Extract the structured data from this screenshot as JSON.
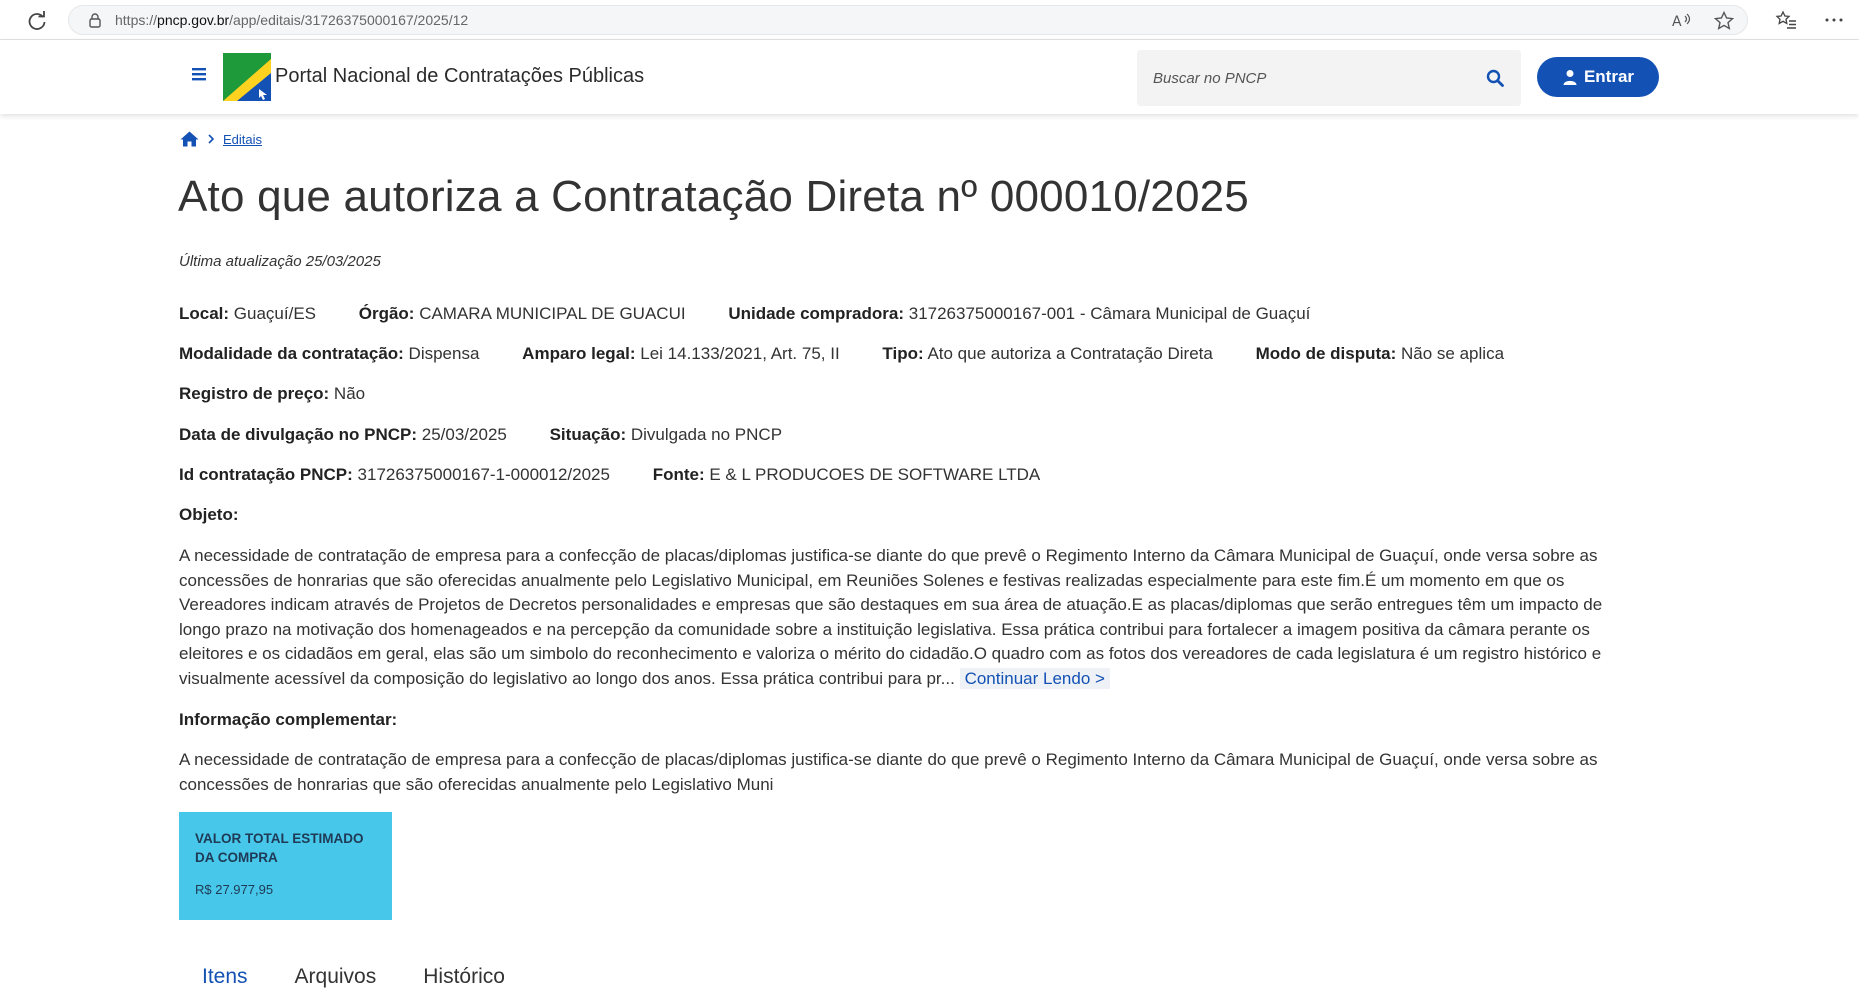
{
  "browser": {
    "url_prefix": "https://",
    "url_host": "pncp.gov.br",
    "url_path": "/app/editais/31726375000167/2025/12"
  },
  "header": {
    "portal_title": "Portal Nacional de Contratações Públicas",
    "search_placeholder": "Buscar no PNCP",
    "login_label": "Entrar"
  },
  "breadcrumb": {
    "editais": "Editais"
  },
  "page": {
    "title": "Ato que autoriza a Contratação Direta nº 000010/2025",
    "last_update": "Última atualização 25/03/2025"
  },
  "fields": {
    "local_label": "Local:",
    "local_value": " Guaçuí/ES",
    "orgao_label": "Órgão:",
    "orgao_value": " CAMARA MUNICIPAL DE GUACUI",
    "unidade_label": "Unidade compradora:",
    "unidade_value": " 31726375000167-001 - Câmara Municipal de Guaçuí",
    "modalidade_label": "Modalidade da contratação:",
    "modalidade_value": " Dispensa",
    "amparo_label": "Amparo legal:",
    "amparo_value": " Lei 14.133/2021, Art. 75, II",
    "tipo_label": "Tipo:",
    "tipo_value": " Ato que autoriza a Contratação Direta",
    "modo_label": "Modo de disputa:",
    "modo_value": " Não se aplica",
    "registro_label": "Registro de preço:",
    "registro_value": " Não",
    "data_label": "Data de divulgação no PNCP:",
    "data_value": " 25/03/2025",
    "situacao_label": "Situação:",
    "situacao_value": " Divulgada no PNCP",
    "id_label": "Id contratação PNCP:",
    "id_value": " 31726375000167-1-000012/2025",
    "fonte_label": "Fonte:",
    "fonte_value": " E & L PRODUCOES DE SOFTWARE LTDA"
  },
  "objeto": {
    "label": "Objeto:",
    "text": "A necessidade de contratação de empresa para a confecção de placas/diplomas justifica-se diante do que prevê o Regimento Interno da Câmara Municipal de Guaçuí, onde versa sobre as concessões de honrarias que são oferecidas anualmente pelo Legislativo Municipal, em Reuniões Solenes e festivas realizadas especialmente para este fim.É um momento em que os Vereadores indicam através de Projetos de Decretos personalidades e empresas que são destaques em sua área de atuação.E as placas/diplomas que serão entregues têm um impacto de longo prazo na motivação dos homenageados e na percepção da comunidade sobre a instituição legislativa. Essa prática contribui para fortalecer a imagem positiva da câmara perante os eleitores e os cidadãos em geral, elas são um simbolo do reconhecimento e valoriza o mérito do cidadão.O quadro com as fotos dos vereadores de cada legislatura é um registro histórico e visualmente acessível da composição do legislativo ao longo dos anos. Essa prática contribui para pr...",
    "more_label": "Continuar Lendo >"
  },
  "info_complementar": {
    "label": "Informação complementar:",
    "text": "A necessidade de contratação de empresa para a confecção de placas/diplomas justifica-se diante do que prevê o Regimento Interno da Câmara Municipal de Guaçuí, onde versa sobre as concessões de honrarias que são oferecidas anualmente pelo Legislativo Muni"
  },
  "value_card": {
    "label": "VALOR TOTAL ESTIMADO DA COMPRA",
    "value": "R$ 27.977,95",
    "color": "#47c7ea"
  },
  "tabs": {
    "itens": "Itens",
    "arquivos": "Arquivos",
    "historico": "Histórico"
  },
  "colors": {
    "primary": "#1351b4"
  }
}
